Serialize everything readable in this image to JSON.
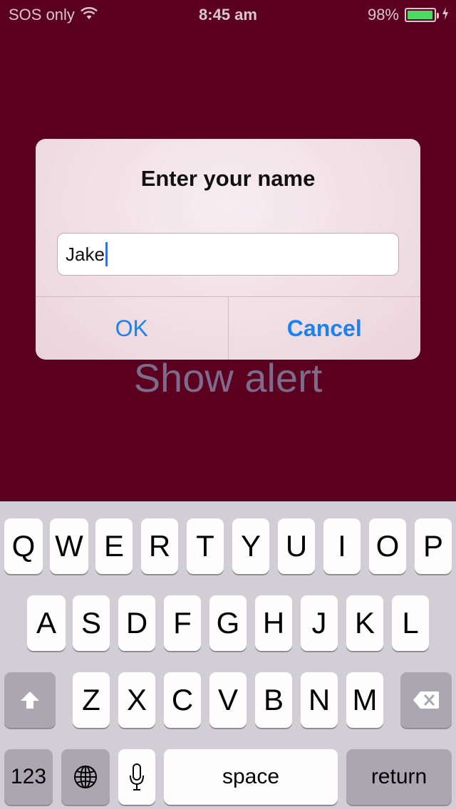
{
  "status": {
    "carrier": "SOS only",
    "time": "8:45 am",
    "battery": "98%",
    "battery_level": 0.98
  },
  "background_button": {
    "label": "Show alert"
  },
  "alert": {
    "title": "Enter your name",
    "input_value": "Jake",
    "ok_label": "OK",
    "cancel_label": "Cancel"
  },
  "keyboard": {
    "row1": [
      "Q",
      "W",
      "E",
      "R",
      "T",
      "Y",
      "U",
      "I",
      "O",
      "P"
    ],
    "row2": [
      "A",
      "S",
      "D",
      "F",
      "G",
      "H",
      "J",
      "K",
      "L"
    ],
    "row3": [
      "Z",
      "X",
      "C",
      "V",
      "B",
      "N",
      "M"
    ],
    "numbers_label": "123",
    "space_label": "space",
    "return_label": "return",
    "icons": [
      "shift-icon",
      "delete-icon",
      "globe-icon",
      "microphone-icon"
    ]
  },
  "colors": {
    "background": "#5c001f",
    "accent": "#1a82f2",
    "battery": "#4cd964"
  }
}
